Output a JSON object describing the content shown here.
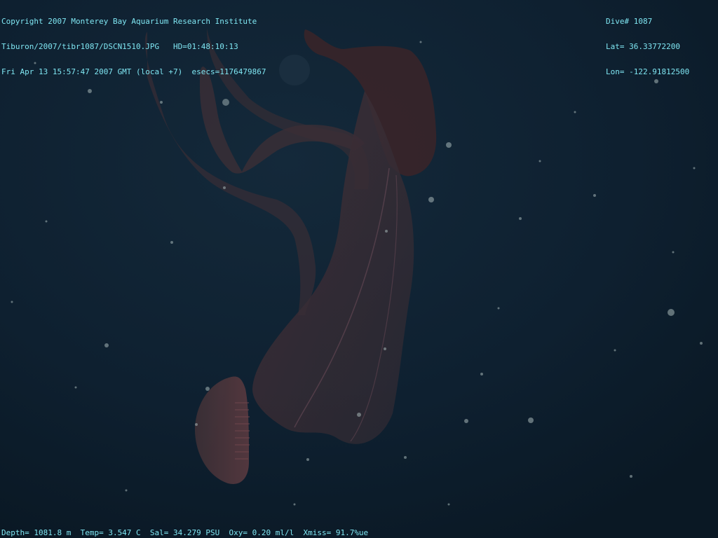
{
  "overlay": {
    "line1": "Copyright 2007 Monterey Bay Aquarium Research Institute",
    "line2": "Tiburon/2007/tibr1087/DSCN1510.JPG   HD=01:48:10:13",
    "line3": "Fri Apr 13 15:57:47 2007 GMT (local +7)  esecs=1176479867",
    "dive": "Dive# 1087",
    "lat": "Lat= 36.33772200",
    "lon": "Lon= -122.91812500",
    "bottom": "Depth= 1081.8 m  Temp= 3.547 C  Sal= 34.279 PSU  Oxy= 0.20 ml/l  Xmiss= 91.7%ue"
  },
  "colors": {
    "water": "#0d1f2e",
    "overlay_text": "#7fe6f2",
    "organism": "#3a2a30"
  }
}
